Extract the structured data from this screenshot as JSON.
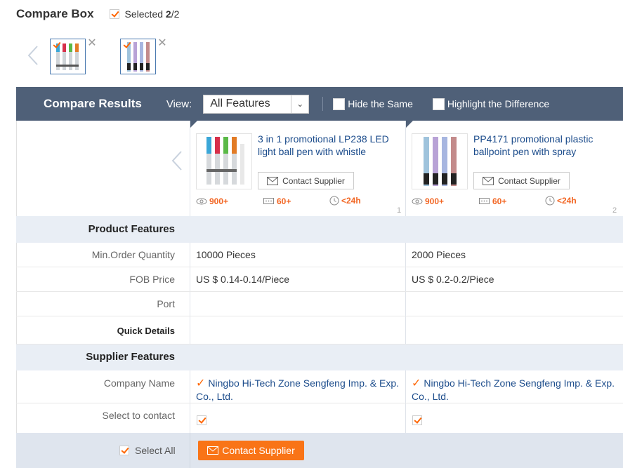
{
  "compare_box": {
    "title": "Compare Box",
    "selected_label": "Selected",
    "selected_count": "2",
    "selected_total": "/2"
  },
  "compare_results": {
    "title": "Compare Results",
    "view_label": "View:",
    "view_value": "All Features",
    "hide_same": "Hide the Same",
    "highlight_diff": "Highlight the Difference"
  },
  "products": [
    {
      "name": "3 in 1 promotional LP238 LED light ball pen with whistle",
      "contact_label": "Contact Supplier",
      "views": "900+",
      "messages": "60+",
      "response": "<24h",
      "index": "1",
      "moq": "10000 Pieces",
      "fob": "US $ 0.14-0.14/Piece",
      "port": "",
      "company": "Ningbo Hi-Tech Zone Sengfeng Imp. & Exp. Co., Ltd."
    },
    {
      "name": "PP4171 promotional plastic ballpoint pen with spray",
      "contact_label": "Contact Supplier",
      "views": "900+",
      "messages": "60+",
      "response": "<24h",
      "index": "2",
      "moq": "2000 Pieces",
      "fob": "US $ 0.2-0.2/Piece",
      "port": "",
      "company": "Ningbo Hi-Tech Zone Sengfeng Imp. & Exp. Co., Ltd."
    }
  ],
  "labels": {
    "product_features": "Product Features",
    "moq": "Min.Order Quantity",
    "fob": "FOB Price",
    "port": "Port",
    "quick_details": "Quick Details",
    "supplier_features": "Supplier Features",
    "company": "Company Name",
    "select_contact": "Select to contact",
    "select_all": "Select All",
    "contact_supplier": "Contact Supplier"
  },
  "colors": {
    "header_bar": "#4f6078",
    "accent": "#f97417",
    "link": "#1d4d8c",
    "stat": "#f26522"
  }
}
